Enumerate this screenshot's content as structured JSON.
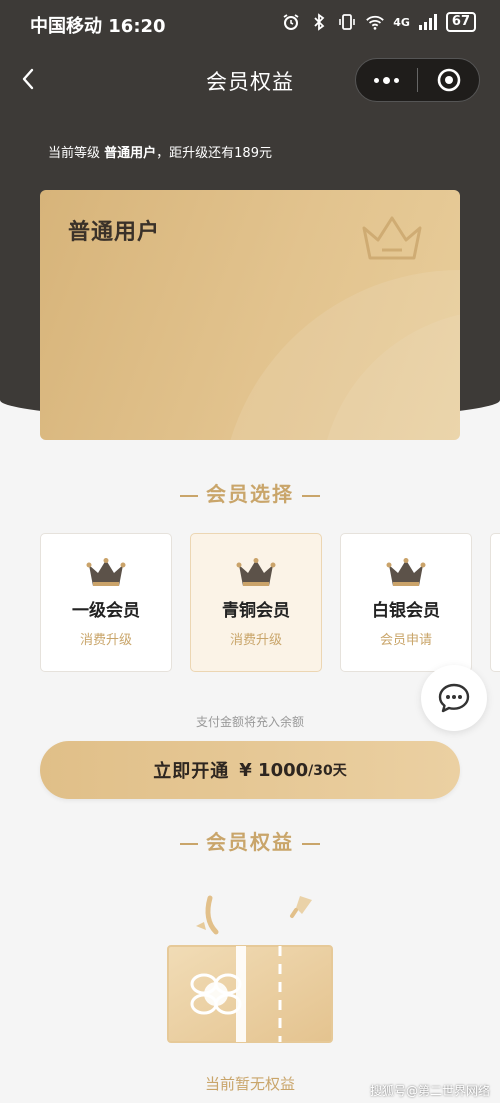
{
  "status_bar": {
    "carrier_time": "中国移动 16:20",
    "network": "4G",
    "battery": "67"
  },
  "nav": {
    "title": "会员权益"
  },
  "level_info": {
    "prefix": "当前等级 ",
    "level": "普通用户",
    "suffix": "，距升级还有189元"
  },
  "card": {
    "title": "普通用户"
  },
  "member_select": {
    "title": "会员选择",
    "tiers": [
      {
        "name": "一级会员",
        "sub": "消费升级",
        "active": false
      },
      {
        "name": "青铜会员",
        "sub": "消费升级",
        "active": true
      },
      {
        "name": "白银会员",
        "sub": "会员申请",
        "active": false
      }
    ]
  },
  "payment": {
    "note": "支付金额将充入余额",
    "button_label": "立即开通",
    "price": "¥ 1000",
    "period": "/30天"
  },
  "benefits": {
    "title": "会员权益",
    "empty_text": "当前暂无权益"
  },
  "watermark": "搜狐号@第二世界网络",
  "colors": {
    "header_bg": "#3d3a37",
    "gold": "#c9a56a",
    "card_gold": "#e2c38e"
  }
}
